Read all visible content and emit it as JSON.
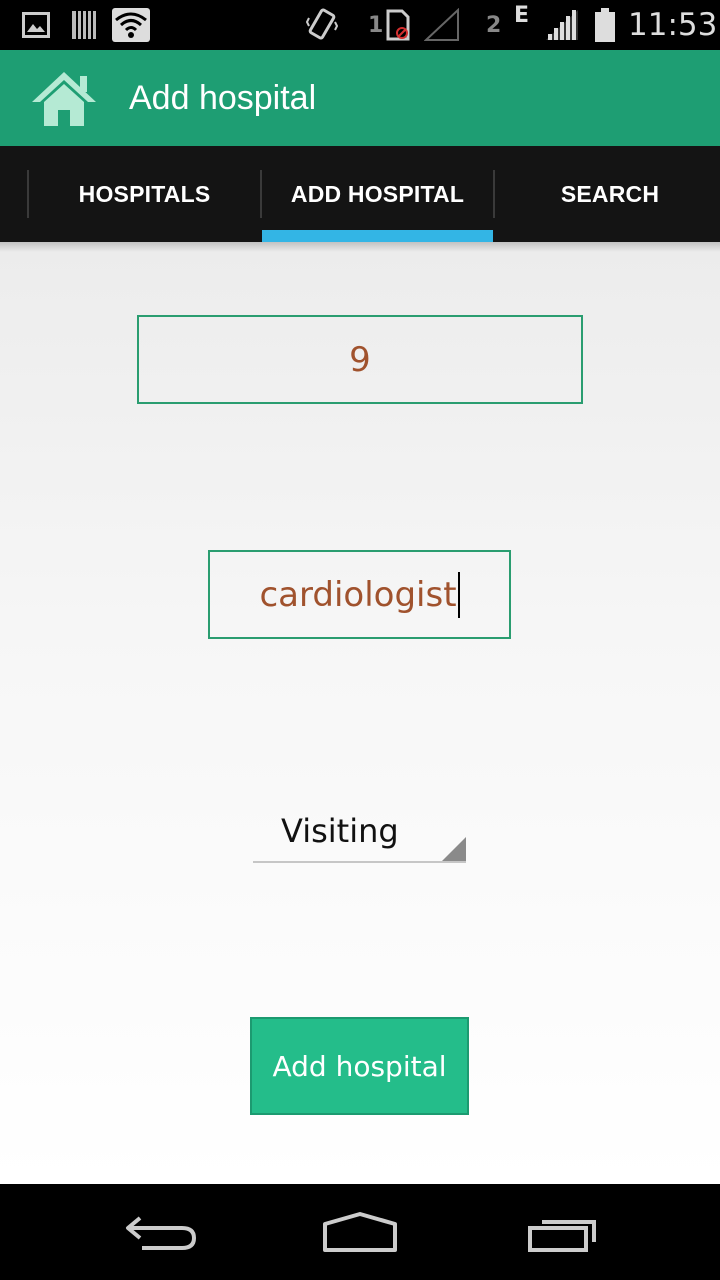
{
  "status_bar": {
    "sim1": "1",
    "sim2": "2",
    "network": "E",
    "time": "11:53"
  },
  "action_bar": {
    "title": "Add hospital",
    "icon": "home-icon"
  },
  "tabs": [
    {
      "label": "HOSPITALS"
    },
    {
      "label": "ADD HOSPITAL",
      "selected": true
    },
    {
      "label": "SEARCH"
    }
  ],
  "form": {
    "field1_value": "9",
    "field2_value": "cardiologist",
    "spinner_value": "Visiting",
    "submit_label": "Add hospital"
  },
  "colors": {
    "accent": "#1e9e73",
    "button": "#24bd8a",
    "tab_indicator": "#33b5e5",
    "field_text": "#a0522d"
  }
}
